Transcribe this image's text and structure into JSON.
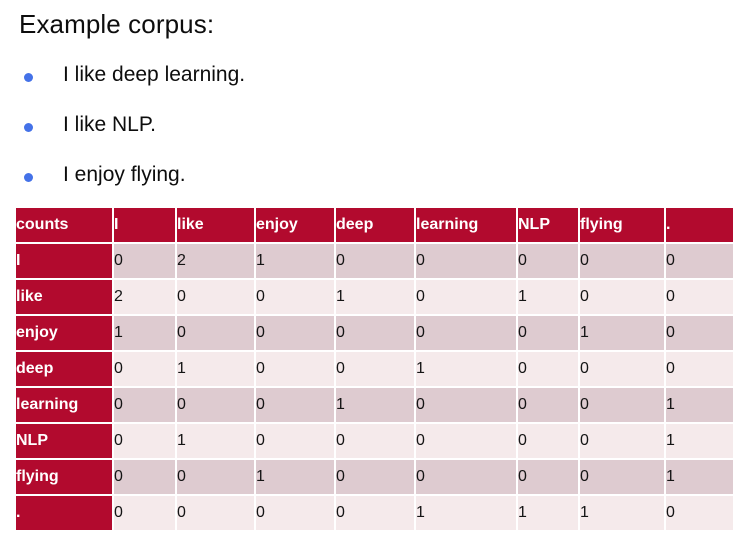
{
  "slide": {
    "title": "Example corpus:",
    "bullet_color": "#4472E8",
    "table_header_color": "#B20A2E",
    "row_band_dark": "#DECBD0",
    "row_band_light": "#F5EAEB"
  },
  "corpus": {
    "sentences": [
      "I like deep learning.",
      "I like NLP.",
      "I enjoy flying."
    ]
  },
  "chart_data": {
    "type": "table",
    "title": "Example corpus:",
    "corner_label": "counts",
    "columns": [
      "I",
      "like",
      "enjoy",
      "deep",
      "learning",
      "NLP",
      "flying",
      "."
    ],
    "rows": [
      "I",
      "like",
      "enjoy",
      "deep",
      "learning",
      "NLP",
      "flying",
      "."
    ],
    "values": [
      [
        0,
        2,
        1,
        0,
        0,
        0,
        0,
        0
      ],
      [
        2,
        0,
        0,
        1,
        0,
        1,
        0,
        0
      ],
      [
        1,
        0,
        0,
        0,
        0,
        0,
        1,
        0
      ],
      [
        0,
        1,
        0,
        0,
        1,
        0,
        0,
        0
      ],
      [
        0,
        0,
        0,
        1,
        0,
        0,
        0,
        1
      ],
      [
        0,
        1,
        0,
        0,
        0,
        0,
        0,
        1
      ],
      [
        0,
        0,
        1,
        0,
        0,
        0,
        0,
        1
      ],
      [
        0,
        0,
        0,
        0,
        1,
        1,
        1,
        0
      ]
    ],
    "xlabel": "",
    "ylabel": "",
    "legend": []
  },
  "table": {
    "header": [
      "counts",
      "I",
      "like",
      "enjoy",
      "deep",
      "learning",
      "NLP",
      "flying",
      "."
    ],
    "body": [
      {
        "label": "I",
        "cells": [
          "0",
          "2",
          "1",
          "0",
          "0",
          "0",
          "0",
          "0"
        ]
      },
      {
        "label": "like",
        "cells": [
          "2",
          "0",
          "0",
          "1",
          "0",
          "1",
          "0",
          "0"
        ]
      },
      {
        "label": "enjoy",
        "cells": [
          "1",
          "0",
          "0",
          "0",
          "0",
          "0",
          "1",
          "0"
        ]
      },
      {
        "label": "deep",
        "cells": [
          "0",
          "1",
          "0",
          "0",
          "1",
          "0",
          "0",
          "0"
        ]
      },
      {
        "label": "learning",
        "cells": [
          "0",
          "0",
          "0",
          "1",
          "0",
          "0",
          "0",
          "1"
        ]
      },
      {
        "label": "NLP",
        "cells": [
          "0",
          "1",
          "0",
          "0",
          "0",
          "0",
          "0",
          "1"
        ]
      },
      {
        "label": "flying",
        "cells": [
          "0",
          "0",
          "1",
          "0",
          "0",
          "0",
          "0",
          "1"
        ]
      },
      {
        "label": ".",
        "cells": [
          "0",
          "0",
          "0",
          "0",
          "1",
          "1",
          "1",
          "0"
        ]
      }
    ]
  }
}
